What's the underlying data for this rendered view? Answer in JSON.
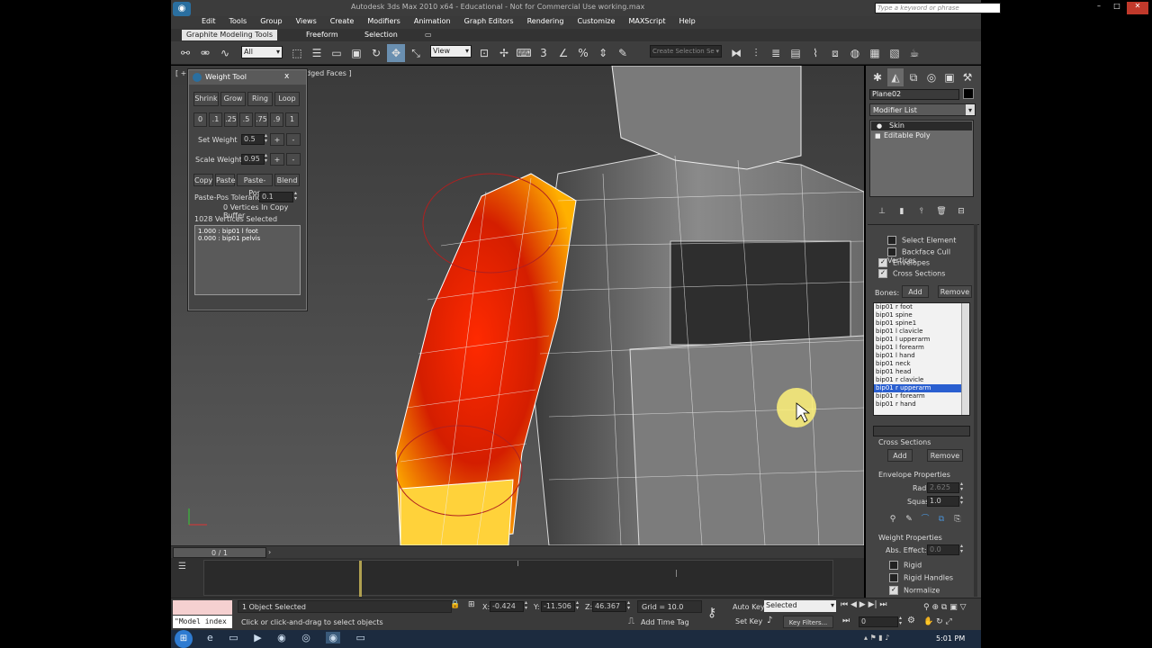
{
  "title_bar": {
    "title": "Autodesk 3ds Max 2010 x64 - Educational - Not for Commercial Use    working.max",
    "search_placeholder": "Type a keyword or phrase"
  },
  "menu": [
    "Edit",
    "Tools",
    "Group",
    "Views",
    "Create",
    "Modifiers",
    "Animation",
    "Graph Editors",
    "Rendering",
    "Customize",
    "MAXScript",
    "Help"
  ],
  "ribbon_tabs": [
    "Graphite Modeling Tools",
    "Freeform",
    "Selection"
  ],
  "toolbar": {
    "filter_value": "All",
    "view_value": "View",
    "selection_set_placeholder": "Create Selection Se"
  },
  "viewport": {
    "label_left": "[ + ]",
    "label_right": "dged Faces ]"
  },
  "weight_tool": {
    "title": "Weight Tool",
    "close": "x",
    "row1": [
      "Shrink",
      "Grow",
      "Ring",
      "Loop"
    ],
    "presets": [
      "0",
      ".1",
      ".25",
      ".5",
      ".75",
      ".9",
      "1"
    ],
    "set_weight_label": "Set Weight",
    "set_weight_value": "0.5",
    "scale_weight_label": "Scale Weight",
    "scale_weight_value": "0.95",
    "plus": "+",
    "minus": "-",
    "row_copy": [
      "Copy",
      "Paste",
      "Paste-Pos",
      "Blend"
    ],
    "paste_tol_label": "Paste-Pos Tolerance",
    "paste_tol_value": "0.1",
    "buffer_text": "0 Vertices In Copy Buffer",
    "selected_text": "1028 Vertices Selected",
    "weights": [
      "1.000 : bip01 l foot",
      "0.000 : bip01 pelvis"
    ]
  },
  "command_panel": {
    "object_name": "Plane02",
    "modifier_list": "Modifier List",
    "stack": [
      "Skin",
      "Editable Poly"
    ],
    "select_element": "Select Element",
    "backface_cull": "Backface Cull Vertices",
    "envelopes": "Envelopes",
    "cross_sections": "Cross Sections",
    "bones_label": "Bones:",
    "add": "Add",
    "remove": "Remove",
    "bones": [
      "bip01 r foot",
      "bip01 spine",
      "bip01 spine1",
      "bip01 l clavicle",
      "bip01 l upperarm",
      "bip01 l forearm",
      "bip01 l hand",
      "bip01 neck",
      "bip01 head",
      "bip01 r clavicle",
      "bip01 r upperarm",
      "bip01 r forearm",
      "bip01 r hand"
    ],
    "selected_bone": "bip01 r upperarm",
    "cross_sections_title": "Cross Sections",
    "envelope_props_title": "Envelope Properties",
    "radius_label": "Radius:",
    "radius_value": "2.625",
    "squash_label": "Squash:",
    "squash_value": "1.0",
    "weight_props_title": "Weight Properties",
    "abs_effect_label": "Abs. Effect:",
    "abs_effect_value": "0.0",
    "rigid": "Rigid",
    "rigid_handles": "Rigid Handles",
    "normalize": "Normalize"
  },
  "timeline": {
    "frame_counter": "0 / 1"
  },
  "status": {
    "maxscript": "\"Model index",
    "selected": "1 Object Selected",
    "prompt": "Click or click-and-drag to select objects",
    "x_label": "X:",
    "x_value": "-0.424",
    "y_label": "Y:",
    "y_value": "-11.506",
    "z_label": "Z:",
    "z_value": "46.367",
    "grid": "Grid = 10.0",
    "add_time_tag": "Add Time Tag",
    "auto_key": "Auto Key",
    "set_key": "Set Key",
    "selected_dropdown": "Selected",
    "key_filters": "Key Filters...",
    "frame_value": "0"
  },
  "taskbar": {
    "time": "5:01 PM"
  }
}
